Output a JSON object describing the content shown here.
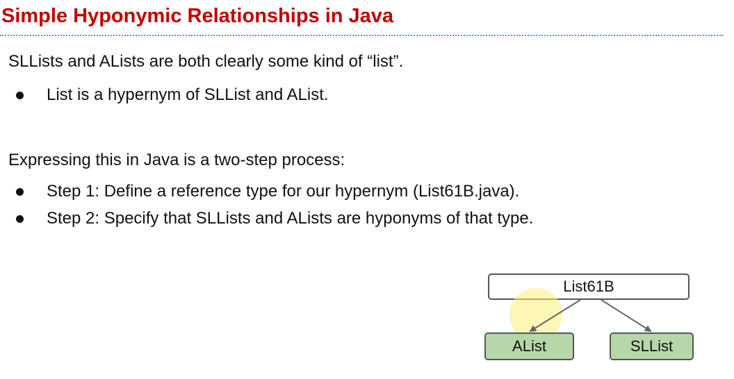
{
  "slide": {
    "title": "Simple Hyponymic Relationships in Java",
    "intro": "SLLists and ALists are both clearly some kind of “list”.",
    "intro_bullets": [
      "List is a hypernym of SLList and AList."
    ],
    "process_intro": "Expressing this in Java is a two-step process:",
    "process_bullets": [
      "Step 1: Define a reference type for our hypernym (List61B.java).",
      "Step 2: Specify that SLLists and ALists are hyponyms of that type."
    ]
  },
  "diagram": {
    "parent": "List61B",
    "children": [
      "AList",
      "SLList"
    ]
  },
  "colors": {
    "title": "#c00000",
    "title_rule": "#3b9fd8",
    "child_fill": "#b6d7a8",
    "node_border": "#555555",
    "arrow": "#666666",
    "highlight": "#faf078"
  }
}
